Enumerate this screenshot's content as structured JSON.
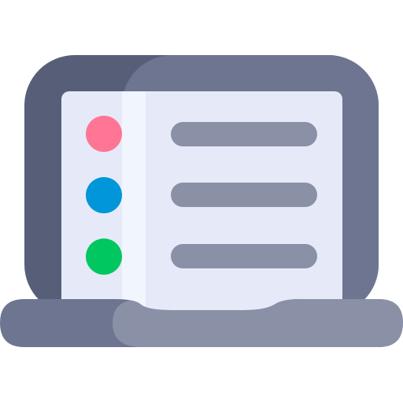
{
  "icon": {
    "name": "laptop-list-icon",
    "colors": {
      "lid_shadow": "#565f77",
      "lid": "#6d7590",
      "screen": "#e6eaf8",
      "screen_highlight": "#f1f5fe",
      "base_shadow": "#6d7590",
      "base": "#8a90a6",
      "line": "#8a90a6",
      "dot_pink": "#ff7595",
      "dot_blue": "#0096d8",
      "dot_green": "#00c75f"
    },
    "list_items": [
      {
        "name": "list-row-1",
        "dot": "dot_pink"
      },
      {
        "name": "list-row-2",
        "dot": "dot_blue"
      },
      {
        "name": "list-row-3",
        "dot": "dot_green"
      }
    ]
  }
}
